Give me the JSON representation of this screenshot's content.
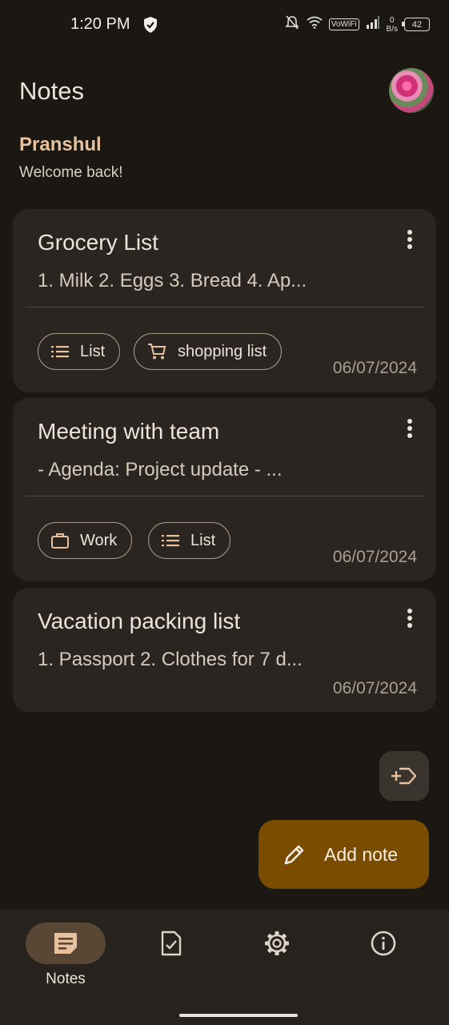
{
  "status_bar": {
    "time": "1:20 PM",
    "vowifi": "VoWiFi",
    "net_speed_value": "0",
    "net_speed_unit": "B/s",
    "battery": "42"
  },
  "header": {
    "title": "Notes",
    "avatar_icon": "profile-photo-flowers"
  },
  "greeting": {
    "name": "Pranshul",
    "subtitle": "Welcome back!"
  },
  "notes": [
    {
      "title": "Grocery List",
      "preview": "1. Milk 2. Eggs 3. Bread 4. Ap...",
      "date": "06/07/2024",
      "tags": [
        {
          "label": "List",
          "icon": "list-icon"
        },
        {
          "label": "shopping list",
          "icon": "cart-icon"
        }
      ]
    },
    {
      "title": "Meeting with team",
      "preview": "- Agenda: Project update - ...",
      "date": "06/07/2024",
      "tags": [
        {
          "label": "Work",
          "icon": "briefcase-icon"
        },
        {
          "label": "List",
          "icon": "list-icon"
        }
      ]
    },
    {
      "title": "Vacation packing list",
      "preview": "1. Passport 2. Clothes for 7 d...",
      "date": "06/07/2024",
      "tags": []
    }
  ],
  "fab": {
    "label": "Add note",
    "icon": "pencil-icon"
  },
  "secondary_fab": {
    "icon": "add-label-icon"
  },
  "bottom_nav": {
    "items": [
      {
        "label": "Notes",
        "icon": "note-icon",
        "active": true
      },
      {
        "label": "",
        "icon": "task-icon",
        "active": false
      },
      {
        "label": "",
        "icon": "settings-icon",
        "active": false
      },
      {
        "label": "",
        "icon": "info-icon",
        "active": false
      }
    ]
  },
  "colors": {
    "background": "#1b1814",
    "card": "#2a2520",
    "accent": "#e8c29e",
    "fab": "#7a4c00",
    "nav_pill": "#5a4634"
  }
}
